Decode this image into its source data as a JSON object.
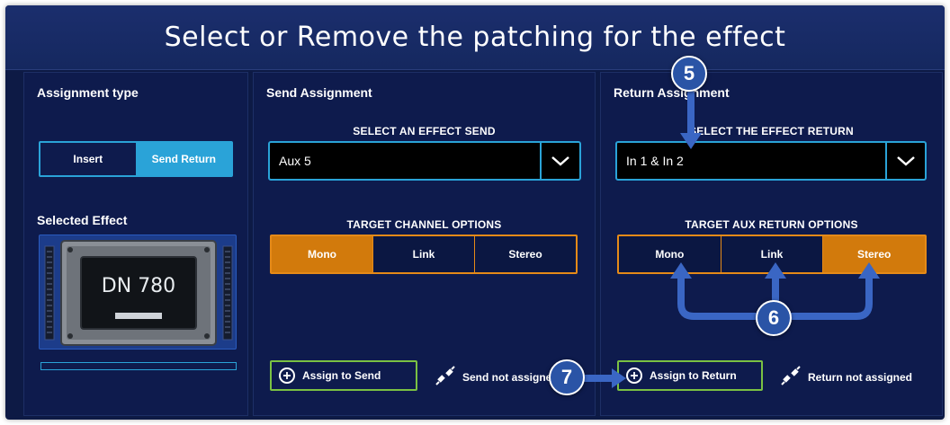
{
  "title": "Select or Remove the patching for the effect",
  "assignment": {
    "heading": "Assignment type",
    "options": [
      "Insert",
      "Send Return"
    ],
    "selected": "Send Return",
    "selected_effect_heading": "Selected Effect",
    "effect_name": "DN 780"
  },
  "send": {
    "heading": "Send Assignment",
    "select_label": "SELECT AN EFFECT SEND",
    "value": "Aux 5",
    "options_label": "TARGET CHANNEL OPTIONS",
    "options": [
      "Mono",
      "Link",
      "Stereo"
    ],
    "selected": "Mono",
    "assign_label": "Assign to Send",
    "status": "Send not assigned"
  },
  "return": {
    "heading": "Return Assignment",
    "select_label": "SELECT THE EFFECT RETURN",
    "value": "In 1 & In 2",
    "options_label": "TARGET AUX RETURN OPTIONS",
    "options": [
      "Mono",
      "Link",
      "Stereo"
    ],
    "selected": "Stereo",
    "assign_label": "Assign to Return",
    "status": "Return not assigned"
  },
  "callouts": [
    "5",
    "6",
    "7"
  ],
  "colors": {
    "background": "#0d1a45",
    "accent_blue": "#2aa3d8",
    "accent_orange": "#d27a0c",
    "accent_green": "#7ac143",
    "callout": "#2a54a6"
  }
}
